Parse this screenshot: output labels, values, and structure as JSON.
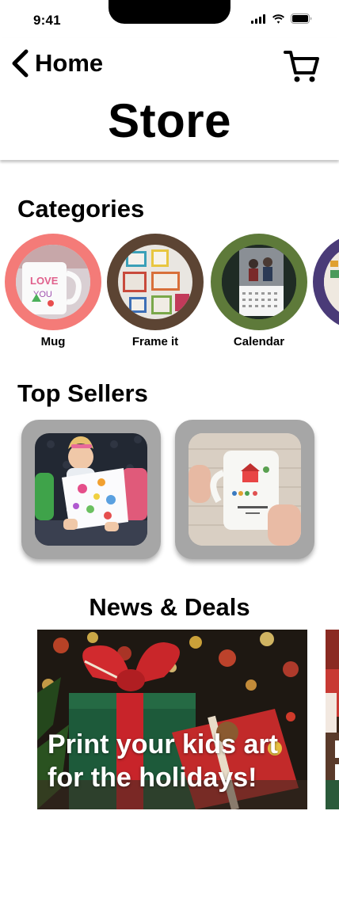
{
  "status_bar": {
    "time": "9:41"
  },
  "header": {
    "back_label": "Home",
    "title": "Store"
  },
  "categories": {
    "title": "Categories",
    "items": [
      {
        "label": "Mug",
        "ring_color": "#f47b78"
      },
      {
        "label": "Frame it",
        "ring_color": "#5c4433"
      },
      {
        "label": "Calendar",
        "ring_color": "#5e7a3a"
      },
      {
        "label": "",
        "ring_color": "#4a3b78"
      }
    ]
  },
  "top_sellers": {
    "title": "Top Sellers",
    "items": [
      {
        "name": "kids art pillow"
      },
      {
        "name": "kids art mug"
      }
    ]
  },
  "news": {
    "title": "News & Deals",
    "items": [
      {
        "line1": "Print your kids art",
        "line2": "for the holidays!"
      }
    ]
  },
  "colors": {
    "card_frame": "#a6a6a6",
    "header_shadow": "#cccccc"
  }
}
